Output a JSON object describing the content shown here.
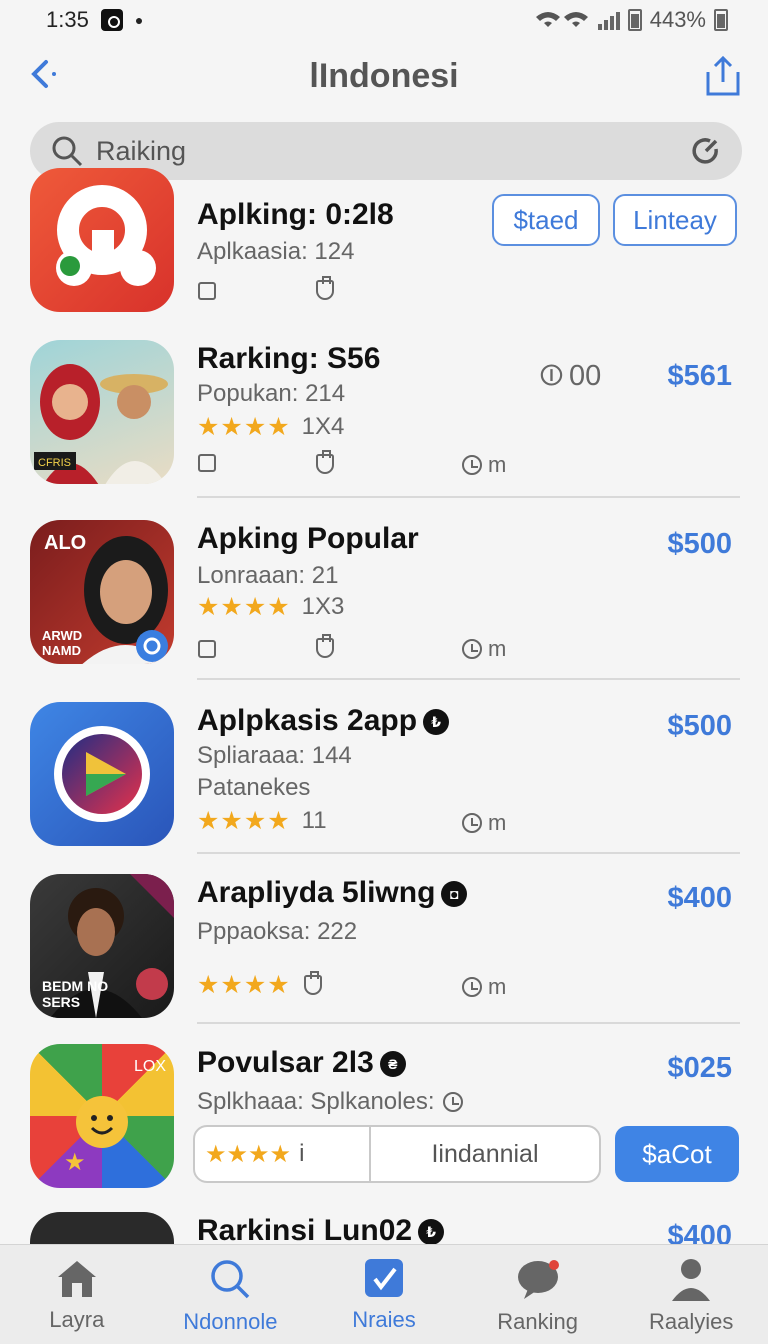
{
  "status": {
    "time": "1:35",
    "battery": "443%"
  },
  "header": {
    "title": "lIndonesi"
  },
  "search": {
    "placeholder": "Raiking"
  },
  "rows": [
    {
      "name": "Aplking: 0:2l8",
      "sub": "Aplkaasia: 124",
      "btn1": "$taed",
      "btn2": "Linteay"
    },
    {
      "name": "Rarking: S56",
      "sub": "Popukan: 214",
      "rating": "★★★★",
      "count": "1X4",
      "badge": "00",
      "price": "$561",
      "meta": "m"
    },
    {
      "name": "Apking Popular",
      "sub": "Lonraaan: 21",
      "rating": "★★★★",
      "count": "1X3",
      "price": "$500",
      "meta": "m",
      "icon_text_top": "ALO",
      "icon_text_bottom": "ARWD NAMD"
    },
    {
      "name": "Aplpkasis 2app",
      "sub": "Spliaraaa: 144",
      "sub2": "Patanekes",
      "rating": "★★★★",
      "count": "11",
      "price": "$500",
      "meta": "m"
    },
    {
      "name": "Arapliyda 5liwng",
      "sub": "Pppaoksa: 222",
      "rating": "★★★★",
      "price": "$400",
      "meta": "m",
      "icon_text_bottom": "BEDM NO SERS"
    },
    {
      "name": "Povulsar 2l3",
      "sub": "Splkhaaa: Splkanoles:",
      "price": "$025",
      "combo_count": "i",
      "combo_label": "Iindannial",
      "blue_btn": "$aCot",
      "icon_text": "LOX"
    },
    {
      "name": "Rarkinsi Lun02",
      "price": "$400"
    }
  ],
  "tabs": [
    {
      "label": "Layra",
      "icon": "home-icon"
    },
    {
      "label": "Ndonnole",
      "icon": "search-icon"
    },
    {
      "label": "Nraies",
      "icon": "edit-icon"
    },
    {
      "label": "Ranking",
      "icon": "chat-icon"
    },
    {
      "label": "Raalyies",
      "icon": "person-icon"
    }
  ],
  "colors": {
    "accent": "#3f7ad9",
    "star": "#f2a81d",
    "background": "#f5f5f5"
  }
}
